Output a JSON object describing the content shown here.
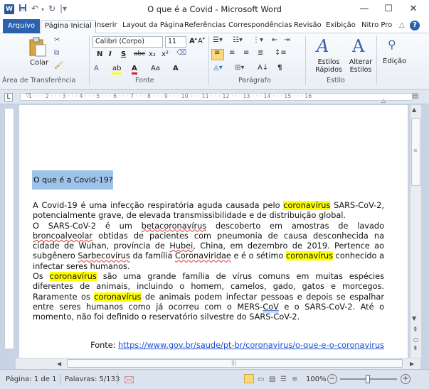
{
  "window": {
    "title": "O que é a Covid  -  Microsoft Word",
    "app_icon": "W",
    "controls": {
      "minimize": "—",
      "maximize": "☐",
      "close": "✕"
    }
  },
  "tabs": [
    "Arquivo",
    "Página Inicial",
    "Inserir",
    "Layout da Página",
    "Referências",
    "Correspondências",
    "Revisão",
    "Exibição",
    "Nitro Pro"
  ],
  "ribbon": {
    "clipboard": {
      "paste": "Colar",
      "label": "Área de Transferência"
    },
    "font": {
      "name": "Calibri (Corpo)",
      "size": "11",
      "bold": "N",
      "italic": "I",
      "underline": "S",
      "strike": "abc",
      "sub": "x₂",
      "sup": "x²",
      "case": "Aa",
      "grow": "A",
      "label": "Fonte"
    },
    "paragraph": {
      "label": "Parágrafo",
      "pilcrow": "¶"
    },
    "styles": {
      "quick": "Estilos Rápidos",
      "change": "Alterar Estilos",
      "label": "Estilo"
    },
    "editing": {
      "label": "Edição"
    }
  },
  "ruler": {
    "numbers": "1 · · · 2 · · · 3 · · · 4 · · · 5 · · · 6 · · · 7 · · · 8 · · · 9 · · · 10 · · · 11 · · · 12 · · · 13 · · · 14 · · · 15 · · · 16"
  },
  "document": {
    "heading": "O que é a Covid-19?",
    "p1_a": "A Covid-19 é uma infecção respiratória aguda causada pelo ",
    "p1_hl": "coronavírus",
    "p1_b": " SARS-CoV-2, potencialmente grave, de elevada transmissibilidade  e de distribuição global.",
    "p2_a": "O  SARS-CoV-2  é  um  ",
    "p2_sq1": "betacoronavírus",
    "p2_b": "  descoberto  em  amostras  de  lavado ",
    "p2_sq2": "broncoalveolar",
    "p2_c": " obtidas de pacientes com pneumonia de causa desconhecida na cidade de Wuhan, província de ",
    "p2_sq3": "Hubei",
    "p2_d": ", China, em dezembro de 2019. Pertence ao subgênero ",
    "p2_sq4": "Sarbecovírus",
    "p2_e": " da família ",
    "p2_sq5": "Coronaviridae",
    "p2_f": " e é o sétimo ",
    "p2_hl": "coronavírus",
    "p2_g": " conhecido a infectar seres humanos.",
    "p3_a": "Os ",
    "p3_hl1": "coronavírus",
    "p3_b": " são uma grande família de vírus comuns em muitas espécies diferentes de animais, incluindo o homem, camelos, gado, gatos e morcegos. Raramente os ",
    "p3_hl2": "coronavírus",
    "p3_c": " de animais podem infectar pessoas e depois se espalhar entre seres humanos como já ocorreu com o MERS-",
    "p3_dq": "CoV",
    "p3_d": " e o SARS-CoV-2. Até o momento, não foi definido o reservatório silvestre do SARS-CoV-2.",
    "source_label": "Fonte: ",
    "source_url": "https://www.gov.br/saude/pt-br/coronavirus/o-que-e-o-coronavirus"
  },
  "status": {
    "page": "Página: 1 de 1",
    "words": "Palavras: 5/133",
    "zoom": "100%",
    "zoom_minus": "−",
    "zoom_plus": "+"
  },
  "colors": {
    "accent": "#2b62b0",
    "highlight": "#ffff00",
    "heading_bg": "#9ec3ea",
    "link": "#1a4fd8"
  }
}
